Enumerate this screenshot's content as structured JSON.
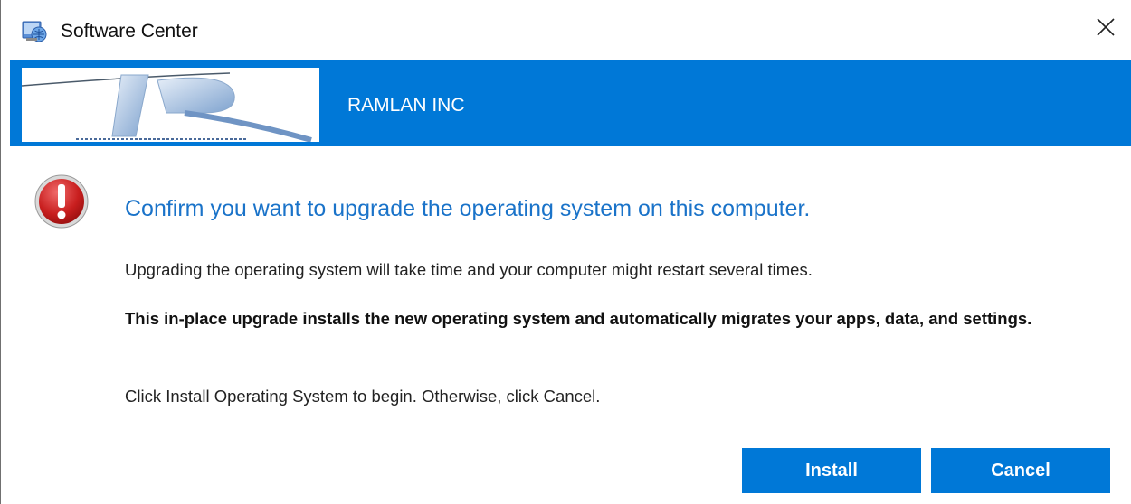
{
  "window": {
    "title": "Software Center",
    "icons": {
      "app": "software-center-icon",
      "close": "close-icon"
    }
  },
  "banner": {
    "organization": "RAMLAN INC",
    "logo": "company-logo",
    "color": "#0078d7"
  },
  "dialog": {
    "icon": "error-alert-icon",
    "heading": "Confirm you want to upgrade the operating system on this computer.",
    "paragraph1": "Upgrading the operating system will take time and your computer might restart several times.",
    "paragraph2": "This in-place upgrade installs the new operating system and automatically migrates your apps, data, and settings.",
    "paragraph3": "Click Install Operating System to begin. Otherwise, click Cancel.",
    "heading_color": "#1a73c9"
  },
  "buttons": {
    "install_label": "Install",
    "cancel_label": "Cancel"
  }
}
